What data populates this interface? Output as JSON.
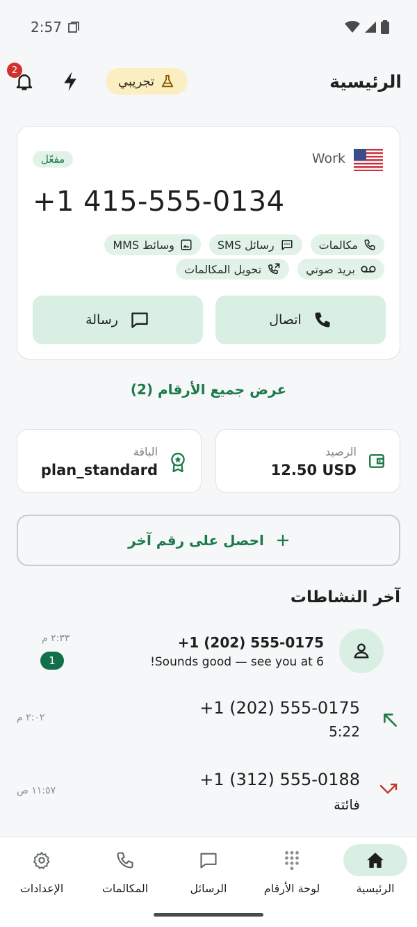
{
  "status_bar": {
    "time": "2:57"
  },
  "header": {
    "title": "الرئيسية",
    "trial_label": "تجريبي",
    "notifications_count": "2"
  },
  "number_card": {
    "label": "Work",
    "status": "مفعّل",
    "phone": "+1 415-555-0134",
    "capabilities_row1": [
      "مكالمات",
      "رسائل SMS",
      "وسائط MMS"
    ],
    "capabilities_row2": [
      "بريد صوتي",
      "تحويل المكالمات"
    ],
    "call_label": "اتصال",
    "message_label": "رسالة"
  },
  "show_all": "عرض جميع الأرقام (2)",
  "balance": {
    "label": "الرصيد",
    "value": "12.50 USD"
  },
  "plan": {
    "label": "الباقة",
    "value": "plan_standard"
  },
  "get_number": "احصل على رقم آخر",
  "activity": {
    "title": "آخر النشاطات",
    "message": {
      "from": "+1 (202) 555-0175",
      "preview": "Sounds good — see you at 6!",
      "time": "٢:٣٣ م",
      "unread": "1"
    },
    "calls": [
      {
        "number": "+1 (202) 555-0175",
        "detail": "5:22",
        "time": "٢:٠٢ م",
        "direction": "outgoing"
      },
      {
        "number": "+1 (312) 555-0188",
        "detail": "فائتة",
        "time": "١١:٥٧ ص",
        "direction": "missed"
      }
    ]
  },
  "nav": {
    "home": "الرئيسية",
    "dialpad": "لوحة الأرقام",
    "messages": "الرسائل",
    "calls": "المكالمات",
    "settings": "الإعدادات"
  },
  "colors": {
    "accent": "#1c7a4a",
    "accent_light": "#d9efe3",
    "missed": "#c0392b",
    "badge": "#d0312d"
  }
}
